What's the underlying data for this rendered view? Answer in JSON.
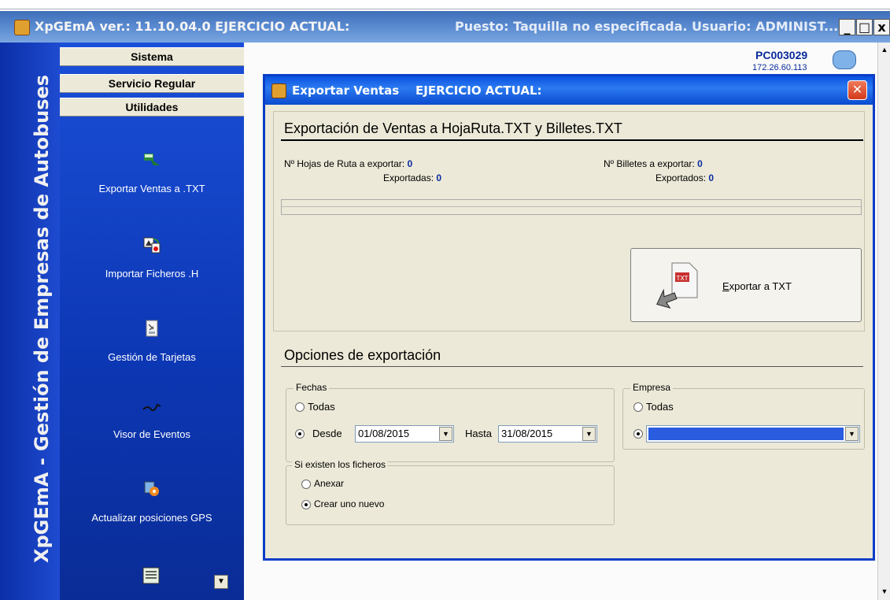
{
  "window": {
    "title": "XpGEmA ver.: 11.10.04.0  EJERCICIO ACTUAL:",
    "status": "Puesto: Taquilla no especificada. Usuario: ADMINIST...",
    "minimize": "_",
    "maximize": "□",
    "close": "x"
  },
  "banner": {
    "text": "XpGEmA - Gestión de Empresas de Autobuses"
  },
  "nav": {
    "groups": [
      "Sistema",
      "Servicio Regular",
      "Utilidades"
    ],
    "items": [
      {
        "label": "Exportar Ventas a .TXT",
        "icon": "export-arrow-icon"
      },
      {
        "label": "Importar Ficheros .H",
        "icon": "import-files-icon"
      },
      {
        "label": "Gestión de Tarjetas",
        "icon": "cards-icon"
      },
      {
        "label": "Visor de Eventos",
        "icon": "event-viewer-icon"
      },
      {
        "label": "Actualizar posiciones GPS",
        "icon": "gps-update-icon"
      }
    ],
    "more": "▼"
  },
  "station": {
    "pc": "PC003029",
    "ip": "172.26.60.113"
  },
  "dialog": {
    "title": "Exportar Ventas    EJERCICIO ACTUAL:",
    "close": "✕",
    "section1_title": "Exportación de Ventas a HojaRuta.TXT y Billetes.TXT",
    "hojas_label": "Nº Hojas de Ruta a exportar:",
    "hojas_value": "0",
    "hojas_exp_label": "Exportadas:",
    "hojas_exp_value": "0",
    "billetes_label": "Nº Billetes a exportar:",
    "billetes_value": "0",
    "billetes_exp_label": "Exportados:",
    "billetes_exp_value": "0",
    "progress": 0,
    "export_button": "Exportar a TXT",
    "export_icon_text": "TXT",
    "section2_title": "Opciones de exportación",
    "fechas": {
      "legend": "Fechas",
      "todas": "Todas",
      "desde": "Desde",
      "desde_value": "01/08/2015",
      "hasta": "Hasta",
      "hasta_value": "31/08/2015",
      "selected": "desde"
    },
    "empresa": {
      "legend": "Empresa",
      "todas": "Todas",
      "value": ""
    },
    "ficheros": {
      "legend": "Si existen los ficheros",
      "anexar": "Anexar",
      "crear": "Crear uno nuevo",
      "selected": "crear"
    }
  },
  "colors": {
    "nav_blue": "#0c36b2",
    "dialog_title": "#0a52e0",
    "value_blue": "#0a2aa0",
    "close_red": "#d23a1a"
  }
}
